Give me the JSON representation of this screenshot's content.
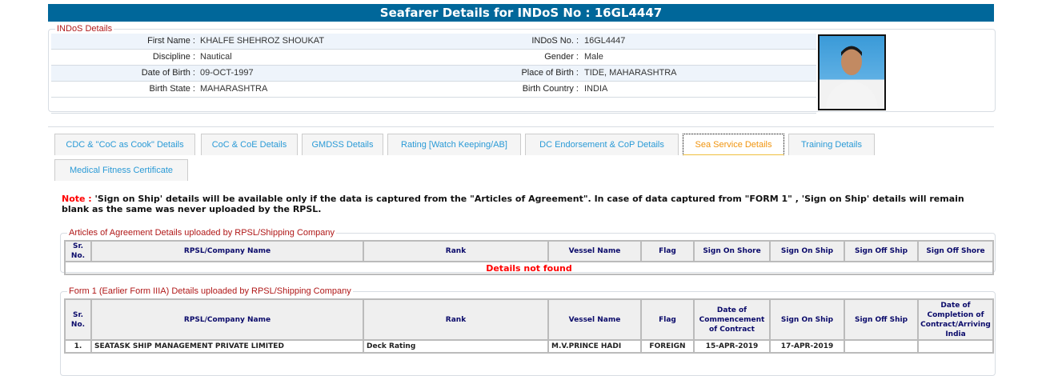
{
  "header": {
    "title": "Seafarer Details for INDoS No : 16GL4447"
  },
  "indos": {
    "legend": "INDoS Details",
    "rows": [
      {
        "l1": "First Name :",
        "v1": "KHALFE SHEHROZ SHOUKAT",
        "l2": "INDoS No. :",
        "v2": "16GL4447"
      },
      {
        "l1": "Discipline :",
        "v1": "Nautical",
        "l2": "Gender :",
        "v2": "Male"
      },
      {
        "l1": "Date of Birth :",
        "v1": "09-OCT-1997",
        "l2": "Place of Birth :",
        "v2": "TIDE, MAHARASHTRA"
      },
      {
        "l1": "Birth State :",
        "v1": "MAHARASHTRA",
        "l2": "Birth Country :",
        "v2": "INDIA"
      }
    ]
  },
  "tabs": [
    "CDC & \"CoC as Cook\" Details",
    "CoC & CoE Details",
    "GMDSS Details",
    "Rating [Watch Keeping/AB]",
    "DC Endorsement & CoP Details",
    "Sea Service Details",
    "Training Details",
    "Medical Fitness Certificate"
  ],
  "note": {
    "label": "Note :",
    "text": " 'Sign on Ship' details will be available only if the data is captured from the \"Articles of Agreement\". In case of data captured from \"FORM 1\" , 'Sign on Ship' details will remain blank as the same was never uploaded by the RPSL."
  },
  "aoa": {
    "legend": "Articles of Agreement Details uploaded by RPSL/Shipping Company",
    "headers": [
      "Sr. No.",
      "RPSL/Company Name",
      "Rank",
      "Vessel Name",
      "Flag",
      "Sign On Shore",
      "Sign On Ship",
      "Sign Off Ship",
      "Sign Off Shore"
    ],
    "empty": "Details not found"
  },
  "form1": {
    "legend": "Form 1 (Earlier Form IIIA) Details uploaded by RPSL/Shipping Company",
    "headers": [
      "Sr. No.",
      "RPSL/Company Name",
      "Rank",
      "Vessel Name",
      "Flag",
      "Date of Commencement of Contract",
      "Sign On Ship",
      "Sign Off Ship",
      "Date of Completion of Contract/Arriving India"
    ],
    "rows": [
      [
        "1.",
        "SEATASK SHIP MANAGEMENT PRIVATE LIMITED",
        "Deck Rating",
        "M.V.PRINCE HADI",
        "FOREIGN",
        "15-APR-2019",
        "17-APR-2019",
        "",
        ""
      ]
    ]
  }
}
